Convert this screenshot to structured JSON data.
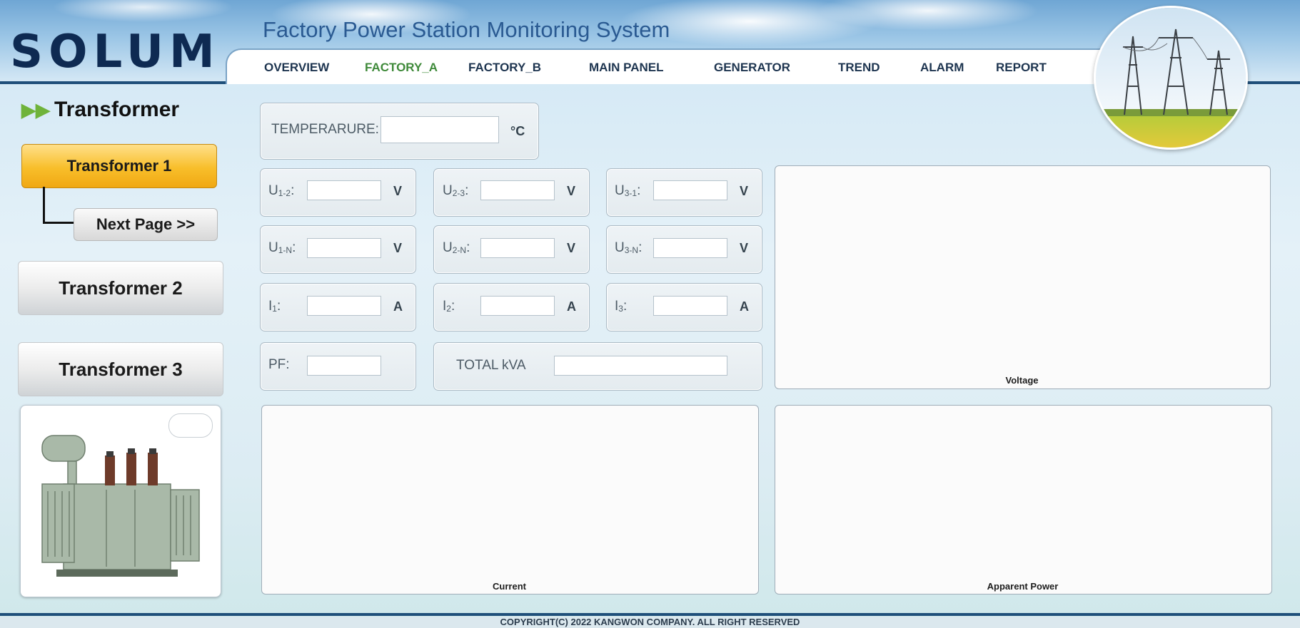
{
  "header": {
    "logo": "SOLUM",
    "title": "Factory Power Station Monitoring System"
  },
  "nav": {
    "items": [
      {
        "label": "OVERVIEW"
      },
      {
        "label": "FACTORY_A",
        "active": true
      },
      {
        "label": "FACTORY_B"
      },
      {
        "label": "MAIN PANEL"
      },
      {
        "label": "GENERATOR"
      },
      {
        "label": "TREND"
      },
      {
        "label": "ALARM"
      },
      {
        "label": "REPORT"
      }
    ],
    "active_color": "#3f8a3a"
  },
  "sidebar": {
    "title": "Transformer",
    "transformer1": "Transformer 1",
    "next_page": "Next Page >>",
    "transformer2": "Transformer 2",
    "transformer3": "Transformer 3"
  },
  "temperature": {
    "label": "TEMPERARURE:",
    "unit": "°C",
    "value": ""
  },
  "measurements": {
    "u12": {
      "label": "U",
      "sub": "1-2",
      "unit": "V",
      "value": ""
    },
    "u23": {
      "label": "U",
      "sub": "2-3",
      "unit": "V",
      "value": ""
    },
    "u31": {
      "label": "U",
      "sub": "3-1",
      "unit": "V",
      "value": ""
    },
    "u1n": {
      "label": "U",
      "sub": "1-N",
      "unit": "V",
      "value": ""
    },
    "u2n": {
      "label": "U",
      "sub": "2-N",
      "unit": "V",
      "value": ""
    },
    "u3n": {
      "label": "U",
      "sub": "3-N",
      "unit": "V",
      "value": ""
    },
    "i1": {
      "label": "I",
      "sub": "1",
      "unit": "A",
      "value": ""
    },
    "i2": {
      "label": "I",
      "sub": "2",
      "unit": "A",
      "value": ""
    },
    "i3": {
      "label": "I",
      "sub": "3",
      "unit": "A",
      "value": ""
    },
    "pf": {
      "label": "PF:",
      "value": ""
    },
    "total_kva": {
      "label": "TOTAL kVA",
      "value": ""
    }
  },
  "charts": {
    "voltage": "Voltage",
    "current": "Current",
    "apparent_power": "Apparent Power"
  },
  "footer": {
    "copyright": "COPYRIGHT(C) 2022 KANGWON COMPANY. ALL RIGHT RESERVED"
  },
  "colors": {
    "brand": "#0e2a52",
    "title": "#2a5a92",
    "selected_button": "#f8be2a"
  }
}
